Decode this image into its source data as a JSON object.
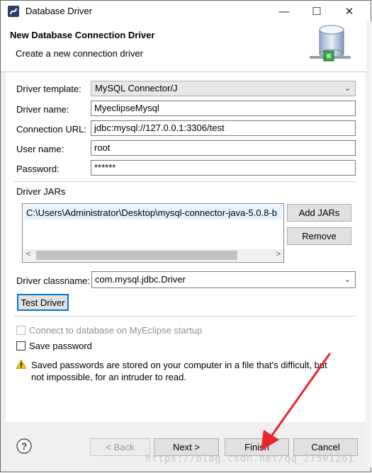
{
  "window": {
    "title": "Database Driver",
    "minimize_glyph": "—",
    "maximize_glyph": "☐",
    "close_glyph": "✕"
  },
  "header": {
    "title": "New Database Connection Driver",
    "description": "Create a new connection driver"
  },
  "form": {
    "driver_template_label": "Driver template:",
    "driver_template_value": "MySQL Connector/J",
    "driver_name_label": "Driver name:",
    "driver_name_value": "MyeclipseMysql",
    "connection_url_label": "Connection URL:",
    "connection_url_value": "jdbc:mysql://127.0.0.1:3306/test",
    "user_name_label": "User name:",
    "user_name_value": "root",
    "password_label": "Password:",
    "password_value": "******"
  },
  "jars": {
    "section_label": "Driver JARs",
    "items": [
      "C:\\Users\\Administrator\\Desktop\\mysql-connector-java-5.0.8-b"
    ],
    "add_button": "Add JARs",
    "remove_button": "Remove",
    "scroll_left": "<",
    "scroll_right": ">"
  },
  "classname": {
    "label": "Driver classname:",
    "value": "com.mysql.jdbc.Driver"
  },
  "test_button": "Test Driver",
  "options": {
    "connect_on_startup_label": "Connect to database on MyEclipse startup",
    "save_password_label": "Save password",
    "warning_text_line1": "Saved passwords are stored on your computer in a file that's difficult, but",
    "warning_text_line2": "not impossible, for an intruder to read."
  },
  "footer": {
    "help_glyph": "?",
    "back_label": "< Back",
    "next_label": "Next >",
    "finish_label": "Finish",
    "cancel_label": "Cancel"
  },
  "watermark": "https://blog.csdn.net/qq_27501261",
  "colors": {
    "annotation_arrow": "#e8272b",
    "accent_blue": "#0078d7"
  }
}
